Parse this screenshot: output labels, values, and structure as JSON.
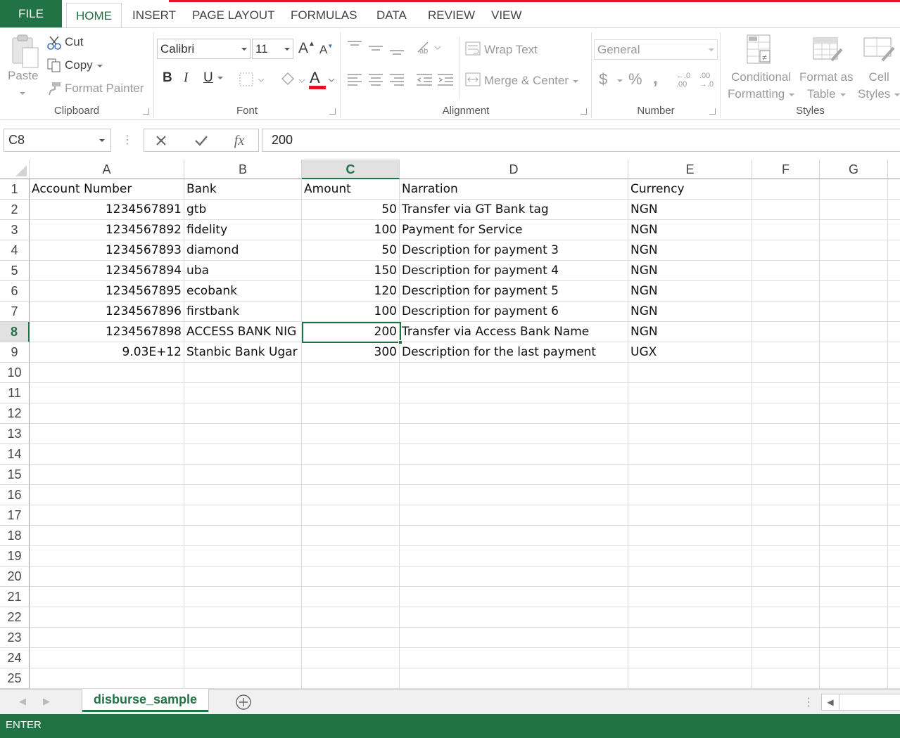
{
  "tabs": {
    "file": "FILE",
    "home": "HOME",
    "insert": "INSERT",
    "page_layout": "PAGE LAYOUT",
    "formulas": "FORMULAS",
    "data": "DATA",
    "review": "REVIEW",
    "view": "VIEW"
  },
  "clipboard": {
    "paste": "Paste",
    "cut": "Cut",
    "copy": "Copy",
    "format_painter": "Format Painter",
    "label": "Clipboard"
  },
  "font": {
    "name": "Calibri",
    "size": "11",
    "bold": "B",
    "italic": "I",
    "underline": "U",
    "label": "Font"
  },
  "alignment": {
    "wrap_text": "Wrap Text",
    "merge_center": "Merge & Center",
    "label": "Alignment"
  },
  "number": {
    "format": "General",
    "currency": "$",
    "percent": "%",
    "comma": ",",
    "label": "Number"
  },
  "styles": {
    "conditional_1": "Conditional",
    "conditional_2": "Formatting",
    "format_table_1": "Format as",
    "format_table_2": "Table",
    "cell_styles_1": "Cell",
    "cell_styles_2": "Styles",
    "label": "Styles"
  },
  "formula_bar": {
    "name_box": "C8",
    "value": "200"
  },
  "columns": [
    "A",
    "B",
    "C",
    "D",
    "E",
    "F",
    "G"
  ],
  "rows": [
    "1",
    "2",
    "3",
    "4",
    "5",
    "6",
    "7",
    "8",
    "9",
    "10",
    "11",
    "12",
    "13",
    "14",
    "15",
    "16",
    "17",
    "18",
    "19",
    "20",
    "21",
    "22",
    "23",
    "24",
    "25"
  ],
  "table": [
    [
      "Account Number",
      "Bank",
      "Amount",
      "Narration",
      "Currency"
    ],
    [
      "1234567891",
      "gtb",
      "50",
      "Transfer via GT Bank tag",
      "NGN"
    ],
    [
      "1234567892",
      "fidelity",
      "100",
      "Payment for Service",
      "NGN"
    ],
    [
      "1234567893",
      "diamond",
      "50",
      "Description for payment 3",
      "NGN"
    ],
    [
      "1234567894",
      "uba",
      "150",
      "Description for payment 4",
      "NGN"
    ],
    [
      "1234567895",
      "ecobank",
      "120",
      "Description for payment 5",
      "NGN"
    ],
    [
      "1234567896",
      "firstbank",
      "100",
      "Description for payment 6",
      "NGN"
    ],
    [
      "1234567898",
      "ACCESS BANK NIG",
      "200",
      "Transfer via Access Bank Name",
      "NGN"
    ],
    [
      "9.03E+12",
      "Stanbic Bank Ugar",
      "300",
      "Description for the last payment",
      "UGX"
    ]
  ],
  "sheet": {
    "name": "disburse_sample"
  },
  "status": {
    "mode": "ENTER"
  },
  "colors": {
    "accent": "#217346",
    "tab_highlight": "#e81123"
  }
}
